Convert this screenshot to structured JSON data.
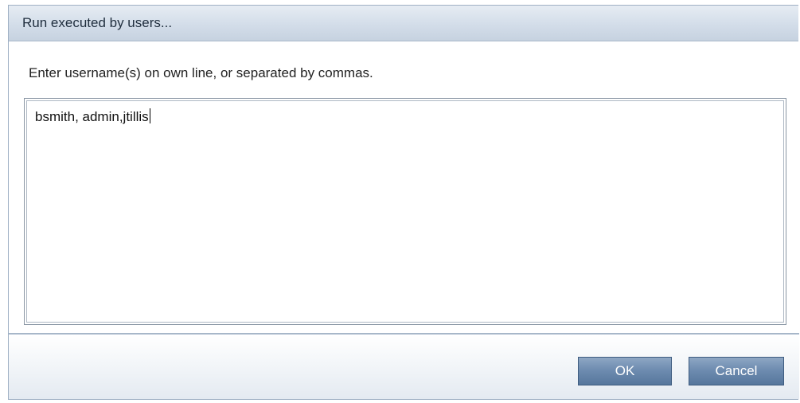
{
  "dialog": {
    "title": "Run executed by users...",
    "instruction": "Enter username(s) on own line, or separated by commas.",
    "usernames_value": "bsmith, admin,jtillis"
  },
  "buttons": {
    "ok_label": "OK",
    "cancel_label": "Cancel"
  },
  "colors": {
    "title_bar": "#d3dde9",
    "button": "#6e8cb0",
    "border": "#9fb0c4"
  }
}
